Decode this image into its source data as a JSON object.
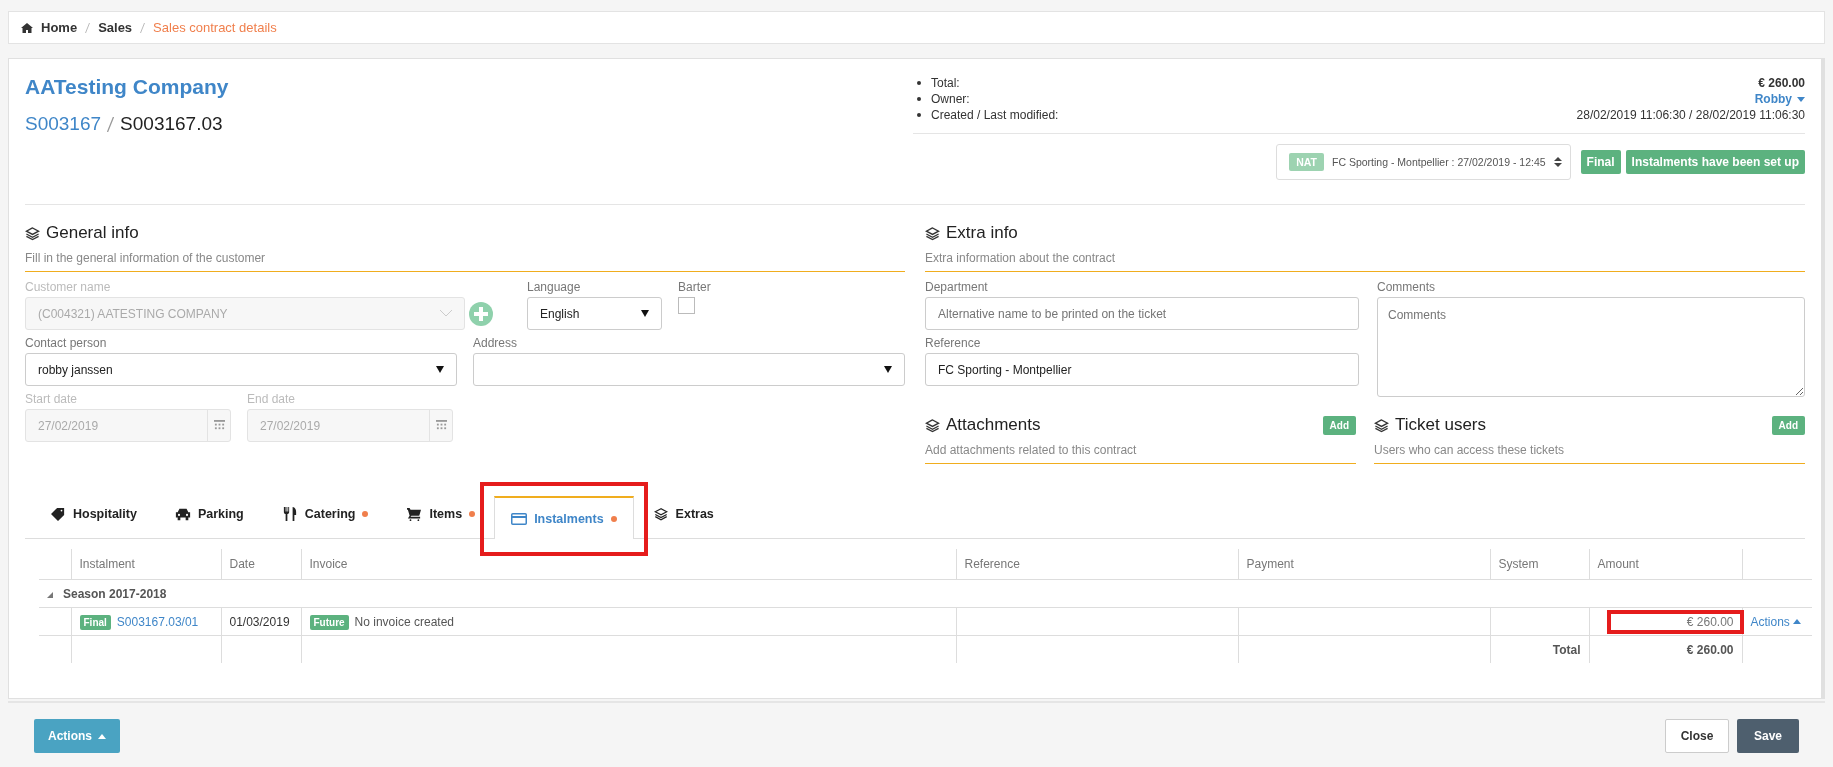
{
  "breadcrumb": [
    {
      "label": "Home",
      "kind": "home"
    },
    {
      "label": "Sales",
      "kind": "link"
    },
    {
      "label": "Sales contract details",
      "kind": "current"
    }
  ],
  "header": {
    "title": "AATesting Company",
    "contract_id": "S003167",
    "version": "S003167.03"
  },
  "summary": [
    {
      "label": "Total:",
      "value": "€ 260.00",
      "kind": "bold"
    },
    {
      "label": "Owner:",
      "value": "Robby",
      "kind": "dropdown"
    },
    {
      "label": "Created / Last modified:",
      "value": "28/02/2019 11:06:30 / 28/02/2019 11:06:30",
      "kind": "text"
    }
  ],
  "event_select": {
    "badge": "NAT",
    "value": "FC Sporting - Montpellier : 27/02/2019 - 12:45"
  },
  "status_badges": [
    "Final",
    "Instalments have been set up"
  ],
  "general_info": {
    "title": "General info",
    "subtitle": "Fill in the general information of the customer",
    "customer_name": {
      "label": "Customer name",
      "value": "(C004321) AATESTING COMPANY",
      "disabled": true
    },
    "language": {
      "label": "Language",
      "value": "English"
    },
    "barter": {
      "label": "Barter",
      "checked": false
    },
    "contact_person": {
      "label": "Contact person",
      "value": "robby janssen"
    },
    "address": {
      "label": "Address"
    },
    "start_date": {
      "label": "Start date",
      "value": "27/02/2019",
      "disabled": true
    },
    "end_date": {
      "label": "End date",
      "value": "27/02/2019",
      "disabled": true
    }
  },
  "extra_info": {
    "title": "Extra info",
    "subtitle": "Extra information about the contract",
    "department": {
      "label": "Department",
      "placeholder": "Alternative name to be printed on the ticket"
    },
    "reference": {
      "label": "Reference",
      "value": "FC Sporting - Montpellier"
    },
    "comments": {
      "label": "Comments",
      "placeholder": "Comments"
    }
  },
  "attachments": {
    "title": "Attachments",
    "subtitle": "Add attachments related to this contract",
    "button": "Add"
  },
  "ticket_users": {
    "title": "Ticket users",
    "subtitle": "Users who can access these tickets",
    "button": "Add"
  },
  "tabs": [
    {
      "label": "Hospitality",
      "marked": false,
      "selected": false,
      "highlighted": false
    },
    {
      "label": "Parking",
      "marked": false,
      "selected": false,
      "highlighted": false
    },
    {
      "label": "Catering",
      "marked": true,
      "selected": false,
      "highlighted": false
    },
    {
      "label": "Items",
      "marked": true,
      "selected": false,
      "highlighted": false
    },
    {
      "label": "Instalments",
      "marked": true,
      "selected": true,
      "highlighted": true
    },
    {
      "label": "Extras",
      "marked": false,
      "selected": false,
      "highlighted": false
    }
  ],
  "table": {
    "columns": [
      "Instalment",
      "Date",
      "Invoice",
      "Reference",
      "Payment",
      "System",
      "Amount"
    ],
    "groups": [
      {
        "label": "Season 2017-2018",
        "expanded": true,
        "rows": [
          {
            "status": "Final",
            "instalment": "S003167.03/01",
            "date": "01/03/2019",
            "invoice_status": "Future",
            "invoice": "No invoice created",
            "amount": "€ 260.00",
            "amount_highlighted": true,
            "action": "Actions"
          }
        ]
      }
    ],
    "total_label": "Total",
    "total": "€ 260.00"
  },
  "footer": {
    "actions": "Actions",
    "close": "Close",
    "save": "Save"
  }
}
